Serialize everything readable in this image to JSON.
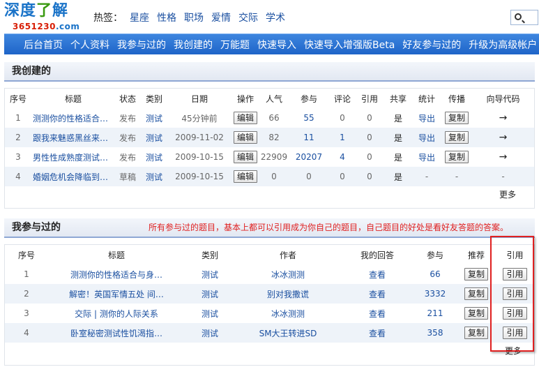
{
  "header": {
    "logo_main_a": "深度",
    "logo_main_b": "了",
    "logo_main_c": "解",
    "logo_sub_a": "3651230",
    "logo_sub_b": ".com",
    "tags_label": "热签：",
    "tags": [
      "星座",
      "性格",
      "职场",
      "爱情",
      "交际",
      "学术"
    ]
  },
  "nav": {
    "items": [
      "后台首页",
      "个人资料",
      "我参与过的",
      "我创建的",
      "万能题",
      "快速导入",
      "快速导入增强版Beta",
      "好友参与过的",
      "升级为高级帐户"
    ]
  },
  "created": {
    "title": "我创建的",
    "headers": [
      "序号",
      "标题",
      "状态",
      "类别",
      "日期",
      "操作",
      "人气",
      "参与",
      "评论",
      "引用",
      "共享",
      "统计",
      "传播",
      "向导代码"
    ],
    "rows": [
      {
        "no": "1",
        "title": "测测你的性格适合…",
        "status": "发布",
        "type": "测试",
        "date": "45分钟前",
        "op": "编辑",
        "pop": "66",
        "join": "55",
        "comment": "0",
        "ref": "0",
        "share": "是",
        "stat": "导出",
        "spread": "复制",
        "guide": "→"
      },
      {
        "no": "2",
        "title": "跟我来魅惑黑丝来…",
        "status": "发布",
        "type": "测试",
        "date": "2009-11-02",
        "op": "编辑",
        "pop": "82",
        "join": "11",
        "comment": "1",
        "ref": "0",
        "share": "是",
        "stat": "导出",
        "spread": "复制",
        "guide": "→"
      },
      {
        "no": "3",
        "title": "男性性成熟度测试…",
        "status": "发布",
        "type": "测试",
        "date": "2009-10-15",
        "op": "编辑",
        "pop": "22909",
        "join": "20207",
        "comment": "4",
        "ref": "0",
        "share": "是",
        "stat": "导出",
        "spread": "复制",
        "guide": "→"
      },
      {
        "no": "4",
        "title": "婚姻危机会降临到…",
        "status": "草稿",
        "type": "测试",
        "date": "2009-10-15",
        "op": "编辑",
        "pop": "0",
        "join": "0",
        "comment": "0",
        "ref": "0",
        "share": "是",
        "stat": "-",
        "spread": "-",
        "guide": "-"
      }
    ],
    "more": "更多"
  },
  "joined": {
    "title": "我参与过的",
    "note": "所有参与过的题目，基本上都可以引用成为你自己的题目，自己题目的好处是看好友答题的答案。",
    "headers": [
      "序号",
      "标题",
      "类别",
      "作者",
      "我的回答",
      "参与",
      "推荐",
      "引用"
    ],
    "rows": [
      {
        "no": "1",
        "title": "测测你的性格适合与身…",
        "type": "测试",
        "author": "冰冰测测",
        "answer": "查看",
        "join": "66",
        "recommend": "复制",
        "ref": "引用"
      },
      {
        "no": "2",
        "title": "解密！英国军情五处 间…",
        "type": "测试",
        "author": "别对我撒谎",
        "answer": "查看",
        "join": "3332",
        "recommend": "复制",
        "ref": "引用"
      },
      {
        "no": "3",
        "title": "交际 | 测你的人际关系",
        "type": "测试",
        "author": "冰冰测测",
        "answer": "查看",
        "join": "211",
        "recommend": "复制",
        "ref": "引用"
      },
      {
        "no": "4",
        "title": "卧室秘密测试性饥渴指…",
        "type": "测试",
        "author": "SM大王转进SD",
        "answer": "查看",
        "join": "358",
        "recommend": "复制",
        "ref": "引用"
      }
    ],
    "more": "更多"
  }
}
